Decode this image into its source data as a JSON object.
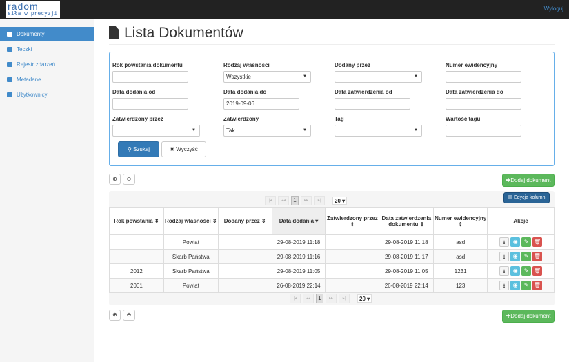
{
  "nav": {
    "logo_line1": "radom",
    "logo_line2": "siła w precyzji",
    "logout": "Wyloguj"
  },
  "sidebar": {
    "items": [
      {
        "label": "Dokumenty",
        "icon": "file-icon",
        "active": true
      },
      {
        "label": "Teczki",
        "icon": "briefcase-icon"
      },
      {
        "label": "Rejestr zdarzeń",
        "icon": "list-icon"
      },
      {
        "label": "Metadane",
        "icon": "tags-icon"
      },
      {
        "label": "Użytkownicy",
        "icon": "users-icon"
      }
    ]
  },
  "page": {
    "title": "Lista Dokumentów"
  },
  "filters": {
    "rok": {
      "label": "Rok powstania dokumentu",
      "value": ""
    },
    "rodzaj": {
      "label": "Rodzaj własności",
      "value": "Wszystkie"
    },
    "dodany": {
      "label": "Dodany przez",
      "value": ""
    },
    "numer": {
      "label": "Numer ewidencyjny",
      "value": ""
    },
    "data_od": {
      "label": "Data dodania od",
      "value": ""
    },
    "data_do": {
      "label": "Data dodania do",
      "value": "2019-09-06"
    },
    "zatw_od": {
      "label": "Data zatwierdzenia od",
      "value": ""
    },
    "zatw_do": {
      "label": "Data zatwierdzenia do",
      "value": ""
    },
    "zatw_przez": {
      "label": "Zatwierdzony przez",
      "value": ""
    },
    "zatwierdzony": {
      "label": "Zatwierdzony",
      "value": "Tak"
    },
    "tag": {
      "label": "Tag",
      "value": ""
    },
    "wartosc": {
      "label": "Wartość tagu",
      "value": ""
    },
    "search": "Szukaj",
    "clear": "Wyczyść"
  },
  "toolbar": {
    "add": "Dodaj dokument",
    "edit_columns": "Edycja kolumn",
    "page": "1",
    "page_size": "20"
  },
  "table": {
    "headers": [
      "Rok powstania ⇕",
      "Rodzaj własności ⇕",
      "Dodany przez ⇕",
      "Data dodania ▾",
      "Zatwierdzony przez ⇕",
      "Data zatwierdzenia dokumentu ⇕",
      "Numer ewidencyjny ⇕",
      "Akcje"
    ],
    "rows": [
      [
        "",
        "Powiat",
        "",
        "29-08-2019 11:18",
        "",
        "29-08-2019 11:18",
        "asd"
      ],
      [
        "",
        "Skarb Państwa",
        "",
        "29-08-2019 11:16",
        "",
        "29-08-2019 11:17",
        "asd"
      ],
      [
        "2012",
        "Skarb Państwa",
        "",
        "29-08-2019 11:05",
        "",
        "29-08-2019 11:05",
        "1231"
      ],
      [
        "2001",
        "Powiat",
        "",
        "26-08-2019 22:14",
        "",
        "26-08-2019 22:14",
        "123"
      ]
    ]
  }
}
